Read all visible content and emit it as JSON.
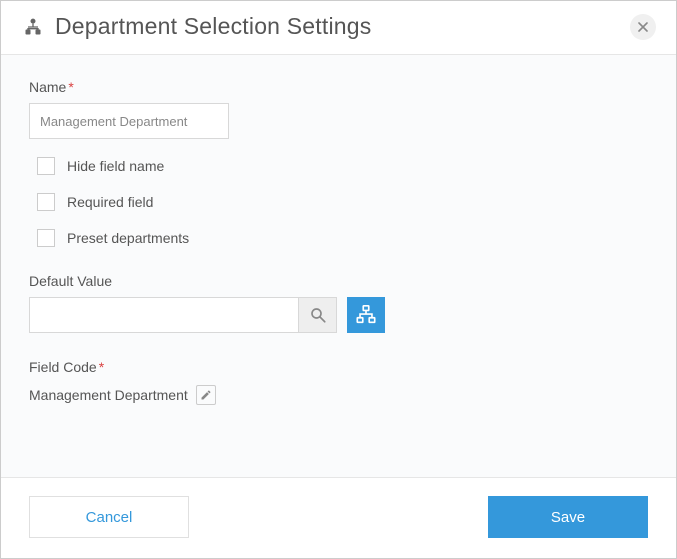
{
  "header": {
    "title": "Department Selection Settings"
  },
  "form": {
    "name_label": "Name",
    "name_value": "Management Department",
    "hide_field_label": "Hide field name",
    "required_label": "Required field",
    "preset_label": "Preset departments",
    "default_value_label": "Default Value",
    "default_value": "",
    "field_code_label": "Field Code",
    "field_code_value": "Management Department"
  },
  "footer": {
    "cancel": "Cancel",
    "save": "Save"
  }
}
